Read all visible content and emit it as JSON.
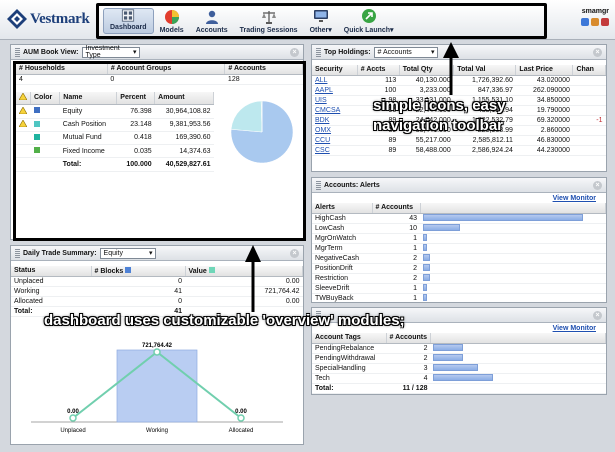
{
  "brand": {
    "name": "Vestmark"
  },
  "nav": {
    "items": [
      {
        "label": "Dashboard",
        "icon": "dashboard-icon",
        "active": true
      },
      {
        "label": "Models",
        "icon": "pie-chart-icon"
      },
      {
        "label": "Accounts",
        "icon": "users-icon"
      },
      {
        "label": "Trading Sessions",
        "icon": "scales-icon"
      },
      {
        "label": "Other",
        "icon": "monitor-icon"
      },
      {
        "label": "Quick Launch",
        "icon": "launch-arrow-icon"
      }
    ]
  },
  "user": {
    "name": "smamgr"
  },
  "aum": {
    "title": "AUM Book View:",
    "view": "Investment Type",
    "summary_headers": [
      "# Households",
      "# Account Groups",
      "# Accounts"
    ],
    "summary_values": [
      "4",
      "0",
      "128"
    ],
    "headers": [
      "",
      "Color",
      "Name",
      "Percent",
      "Amount"
    ],
    "rows": [
      {
        "warn": true,
        "color": "#3f6fc2",
        "name": "Equity",
        "percent": "76.398",
        "amount": "30,964,108.82"
      },
      {
        "warn": true,
        "color": "#4fc6c2",
        "name": "Cash Position",
        "percent": "23.148",
        "amount": "9,381,953.56"
      },
      {
        "warn": false,
        "color": "#1fb39f",
        "name": "Mutual Fund",
        "percent": "0.418",
        "amount": "169,390.60"
      },
      {
        "warn": false,
        "color": "#52b049",
        "name": "Fixed Income",
        "percent": "0.035",
        "amount": "14,374.63"
      }
    ],
    "total": {
      "label": "Total:",
      "percent": "100.000",
      "amount": "40,529,827.61"
    }
  },
  "holdings": {
    "title": "Top Holdings:",
    "view": "# Accounts",
    "headers": [
      "Security",
      "# Accts",
      "Total Qty",
      "Total Val",
      "Last Price",
      "Chan"
    ],
    "rows": [
      [
        "ALL",
        "113",
        "40,130.000",
        "1,726,392.60",
        "43.020000",
        ""
      ],
      [
        "AAPL",
        "100",
        "3,233.000",
        "847,336.97",
        "262.090000",
        ""
      ],
      [
        "UIS",
        "98",
        "33,131.000",
        "1,155,531.10",
        "34.850000",
        ""
      ],
      [
        "CMCSA",
        "96",
        "22,444.000",
        "435,123.94",
        "19.790000",
        ""
      ],
      [
        "BDK",
        "89",
        "24,742.000",
        "1,722,532.79",
        "69.320000",
        "-1"
      ],
      [
        "OMX",
        "89",
        "80,441.000",
        "229,963.99",
        "2.860000",
        ""
      ],
      [
        "CCU",
        "89",
        "55,217.000",
        "2,585,812.11",
        "46.830000",
        ""
      ],
      [
        "CSC",
        "89",
        "58,488.000",
        "2,586,924.24",
        "44.230000",
        ""
      ]
    ]
  },
  "alerts": {
    "title": "Accounts: Alerts",
    "view_monitor": "View Monitor",
    "headers": [
      "Alerts",
      "# Accounts",
      ""
    ],
    "rows": [
      {
        "name": "HighCash",
        "count": 43
      },
      {
        "name": "LowCash",
        "count": 10
      },
      {
        "name": "MgrOnWatch",
        "count": 1
      },
      {
        "name": "MgrTerm",
        "count": 1
      },
      {
        "name": "NegativeCash",
        "count": 2
      },
      {
        "name": "PositionDrift",
        "count": 2
      },
      {
        "name": "Restriction",
        "count": 2
      },
      {
        "name": "SleeveDrift",
        "count": 1
      },
      {
        "name": "TWBuyBack",
        "count": 1
      }
    ]
  },
  "tags": {
    "view_monitor": "View Monitor",
    "headers": [
      "Account Tags",
      "# Accounts",
      ""
    ],
    "rows": [
      {
        "name": "PendingRebalance",
        "count": 2
      },
      {
        "name": "PendingWithdrawal",
        "count": 2
      },
      {
        "name": "SpecialHandling",
        "count": 3
      },
      {
        "name": "Tech",
        "count": 4
      }
    ],
    "total": {
      "label": "Total:",
      "value": "11 / 128"
    }
  },
  "trade": {
    "title": "Daily Trade Summary:",
    "view": "Equity",
    "headers": [
      "Status",
      "# Blocks",
      "Value"
    ],
    "header_colors": [
      "#4f82d6",
      "#6fd6b8"
    ],
    "rows": [
      [
        "Unplaced",
        "0",
        "0.00"
      ],
      [
        "Working",
        "41",
        "721,764.42"
      ],
      [
        "Allocated",
        "0",
        "0.00"
      ]
    ],
    "total_label": "Total:",
    "total_value": "41"
  },
  "chart_data": {
    "type": "bar",
    "categories": [
      "Unplaced",
      "Working",
      "Allocated"
    ],
    "series": [
      {
        "values": [
          0,
          41,
          0
        ],
        "color": "#b9cdf2"
      },
      {
        "values": [
          0.0,
          721764.42,
          0.0
        ],
        "color": "#71cfae"
      }
    ],
    "data_labels": [
      "0.00",
      "721,764.42",
      "0.00"
    ]
  },
  "pie_data": {
    "type": "pie",
    "values": [
      76.398,
      23.148,
      0.418,
      0.035
    ],
    "colors": [
      "#a9c9ef",
      "#bde8ee",
      "#1fb39f",
      "#52b049"
    ]
  },
  "callouts": {
    "nav": "simple icons, easy navigation toolbar",
    "modules": "dashboard uses customizable 'overview' modules;"
  }
}
